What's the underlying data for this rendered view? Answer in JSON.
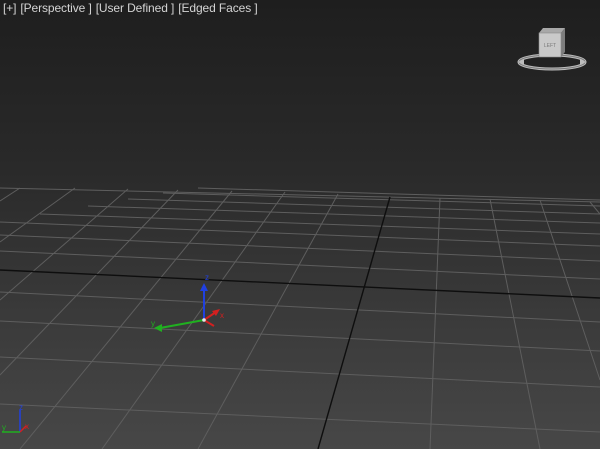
{
  "viewport": {
    "menu": {
      "plus_label": "[+]",
      "view_label": "[Perspective ]",
      "shading_label": "[User Defined ]",
      "edged_label": "[Edged Faces ]"
    },
    "viewcube": {
      "face_label": "LEFT",
      "icon": "viewcube-icon"
    },
    "gizmo": {
      "x_label": "x",
      "y_label": "y",
      "z_label": "z",
      "icon": "transform-gizmo-icon"
    },
    "axis_tripod": {
      "x_label": "x",
      "y_label": "y",
      "z_label": "z",
      "icon": "world-axis-tripod-icon"
    },
    "colors": {
      "x_axis": "#d22020",
      "y_axis": "#20b020",
      "z_axis": "#2040e0",
      "grid": "#5e5e5e",
      "grid_main": "#0e0e0e"
    }
  }
}
